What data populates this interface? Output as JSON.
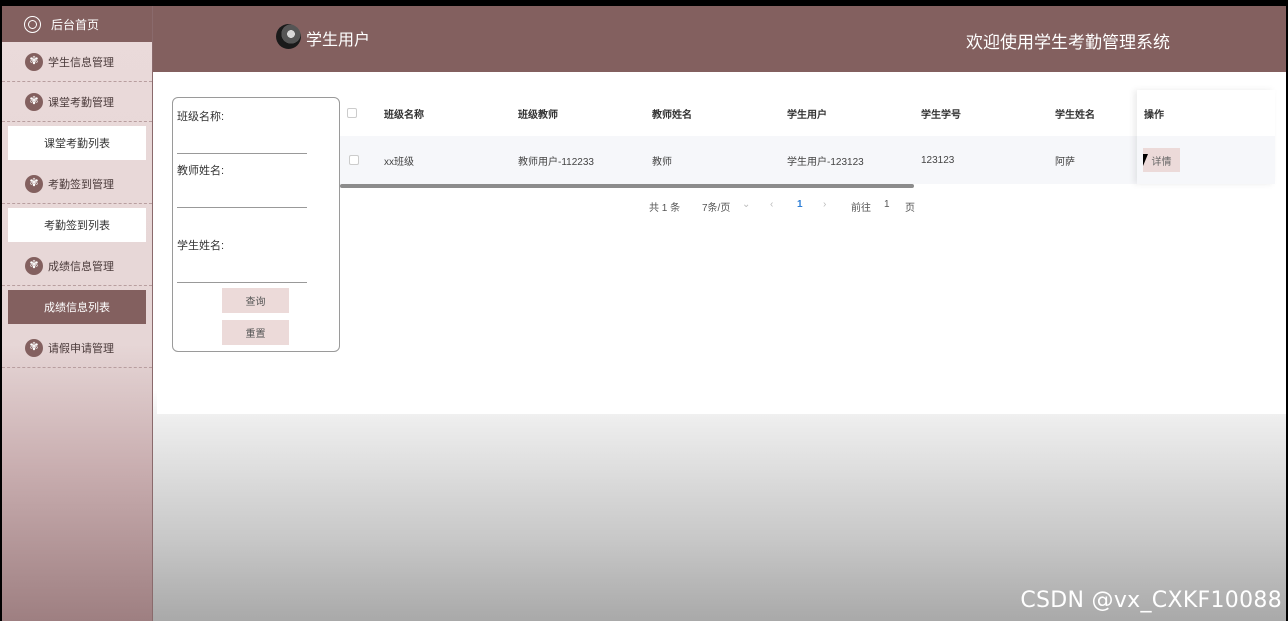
{
  "sidebar": {
    "home": "后台首页",
    "groups": [
      {
        "label": "学生信息管理"
      },
      {
        "label": "课堂考勤管理",
        "sub": "课堂考勤列表"
      },
      {
        "label": "考勤签到管理",
        "sub": "考勤签到列表"
      },
      {
        "label": "成绩信息管理",
        "sub": "成绩信息列表"
      },
      {
        "label": "请假申请管理"
      }
    ],
    "active_item": "成绩信息列表"
  },
  "header": {
    "user": "学生用户",
    "welcome": "欢迎使用学生考勤管理系统"
  },
  "search": {
    "class_label": "班级名称:",
    "teacher_label": "教师姓名:",
    "student_label": "学生姓名:",
    "query_button": "查询",
    "reset_button": "重置"
  },
  "table": {
    "columns": [
      "班级名称",
      "班级教师",
      "教师姓名",
      "学生用户",
      "学生学号",
      "学生姓名",
      "操作"
    ],
    "rows": [
      {
        "class_name": "xx班级",
        "class_teacher": "教师用户-112233",
        "teacher_name": "教师",
        "student_user": "学生用户-123123",
        "student_no": "123123",
        "student_name": "阿萨",
        "action": "详情"
      }
    ]
  },
  "pagination": {
    "total": "共 1 条",
    "page_size": "7条/页",
    "current": "1",
    "goto_prefix": "前往",
    "goto_value": "1",
    "goto_suffix": "页"
  },
  "watermark": "CSDN @vx_CXKF10088",
  "colors": {
    "brand": "#83605f",
    "button_bg": "#ecdad9",
    "link": "#2f7fd6"
  }
}
